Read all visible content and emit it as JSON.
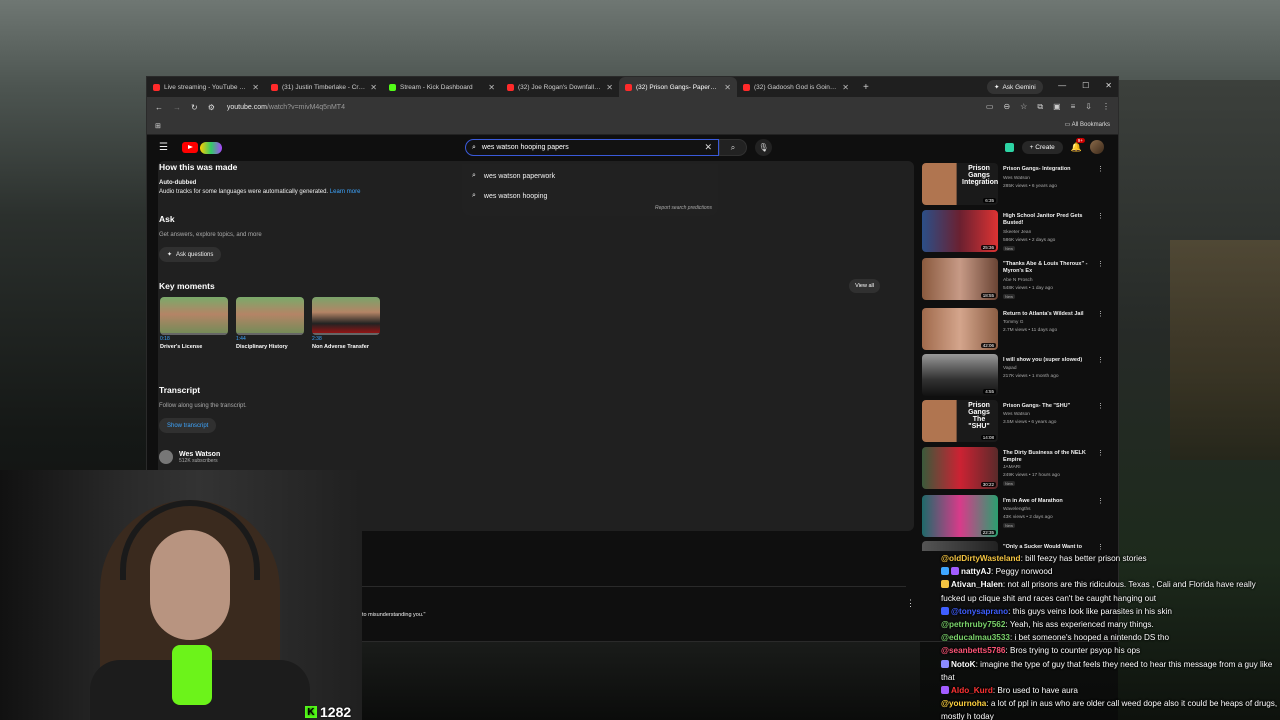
{
  "browser": {
    "tabs": [
      {
        "label": "Live streaming - YouTube Studio",
        "favicon": "youtube"
      },
      {
        "label": "(31) Justin Timberlake - Cry Me",
        "favicon": "youtube"
      },
      {
        "label": "Stream - Kick Dashboard",
        "favicon": "kick"
      },
      {
        "label": "(32) Joe Rogan's Downfall Is Ha",
        "favicon": "youtube"
      },
      {
        "label": "(32) Prison Gangs- Paperwork",
        "favicon": "youtube",
        "active": true
      },
      {
        "label": "(32) Gadoosh God is Going to",
        "favicon": "youtube"
      }
    ],
    "gemini_label": "Ask Gemini",
    "url_main": "youtube.com",
    "url_rest": "/watch?v=mivM4q5nMT4",
    "bookmarks_label": "All Bookmarks"
  },
  "youtube": {
    "search": {
      "query": "wes watson hooping papers",
      "suggestions": [
        "wes watson paperwork",
        "wes watson hooping"
      ],
      "report": "Report search predictions"
    },
    "create_label": "Create",
    "notif_count": "9+"
  },
  "description": {
    "how_made_title": "How this was made",
    "auto_dubbed": "Auto-dubbed",
    "auto_dubbed_text": "Audio tracks for some languages were automatically generated.",
    "learn_more": "Learn more",
    "ask_title": "Ask",
    "ask_text": "Get answers, explore topics, and more",
    "ask_button": "Ask questions",
    "key_moments_title": "Key moments",
    "view_all": "View all",
    "moments": [
      {
        "time": "0:18",
        "title": "Driver's License"
      },
      {
        "time": "1:44",
        "title": "Disciplinary History"
      },
      {
        "time": "2:38",
        "title": "Non Adverse Transfer"
      }
    ],
    "transcript_title": "Transcript",
    "transcript_text": "Follow along using the transcript.",
    "show_transcript": "Show transcript",
    "channel_name": "Wes Watson",
    "channel_subs": "512K subscribers"
  },
  "comment_fragment": "to misunderstanding you.\"",
  "recommendations": [
    {
      "title": "Prison Gangs- Integration",
      "channel": "Wes Watson",
      "meta": "285K views • 6 years ago",
      "duration": "6:35",
      "thumb_text": "Prison Gangs Integration"
    },
    {
      "title": "High School Janitor Pred Gets Busted!",
      "channel": "Skeeter Jean",
      "meta": "586K views • 2 days ago",
      "duration": "25:36",
      "new": "New"
    },
    {
      "title": "\"Thanks Abe & Louis Theroux\" - Myron's Ex",
      "channel": "Abe N Prosch",
      "meta": "548K views • 1 day ago",
      "duration": "18:55",
      "new": "New"
    },
    {
      "title": "Return to Atlanta's Wildest Jail",
      "channel": "Tommy G",
      "meta": "2.7M views • 11 days ago",
      "duration": "42:06"
    },
    {
      "title": "I will show you (super slowed)",
      "channel": "Vapad",
      "meta": "217K views • 1 month ago",
      "duration": "4:55"
    },
    {
      "title": "Prison Gangs- The \"SHU\"",
      "channel": "Wes Watson",
      "meta": "3.5M views • 6 years ago",
      "duration": "14:08",
      "thumb_text": "Prison Gangs The \"SHU\""
    },
    {
      "title": "The Dirty Business of the NELK Empire",
      "channel": "JAMARI",
      "meta": "249K views • 17 hours ago",
      "duration": "30:22",
      "new": "New"
    },
    {
      "title": "I'm in Awe of Marathon",
      "channel": "Wavelengths",
      "meta": "43K views • 2 days ago",
      "duration": "22:35",
      "new": "New"
    },
    {
      "title": "\"Only a Sucker Would Want to",
      "channel": "",
      "meta": "",
      "duration": ""
    }
  ],
  "chat": [
    {
      "user": "@oldDirtyWasteland",
      "text": "bill feezy has better prison stories",
      "color": "#f5c542"
    },
    {
      "user": "nattyAJ",
      "text": "Peggy norwood",
      "color": "#ffffff"
    },
    {
      "user": "Ativan_Halen",
      "text": "not all prisons are this ridiculous. Texas , Cali and Florida have really fucked up clique shit and races can't be caught hanging out",
      "color": "#ffffff"
    },
    {
      "user": "@tonysaprano",
      "text": "this guys veins look like parasites in his skin",
      "color": "#3f5fff"
    },
    {
      "user": "@petrhruby7562",
      "text": "Yeah, his ass experienced many things.",
      "color": "#7bd36b"
    },
    {
      "user": "@educalmau3533",
      "text": "i bet someone's hooped a nintendo DS tho",
      "color": "#7bd36b"
    },
    {
      "user": "@seanbetts5786",
      "text": "Bros trying to counter psyop his ops",
      "color": "#ff5577"
    },
    {
      "user": "NotoK",
      "text": "imagine the type of guy that feels they need to hear this message from a guy like that",
      "color": "#ffffff"
    },
    {
      "user": "Aldo_Kurd",
      "text": "Bro used to have aura",
      "color": "#ff3333"
    },
    {
      "user": "@yournoha",
      "text": "a lot of ppl in aus who are older call weed dope also it could be heaps of drugs, mostly h today",
      "color": "#ffd23f"
    }
  ],
  "viewer_count": "1282",
  "colors": {
    "accent": "#3ea6ff",
    "youtube_red": "#ff0000",
    "kick_green": "#53fc18"
  }
}
